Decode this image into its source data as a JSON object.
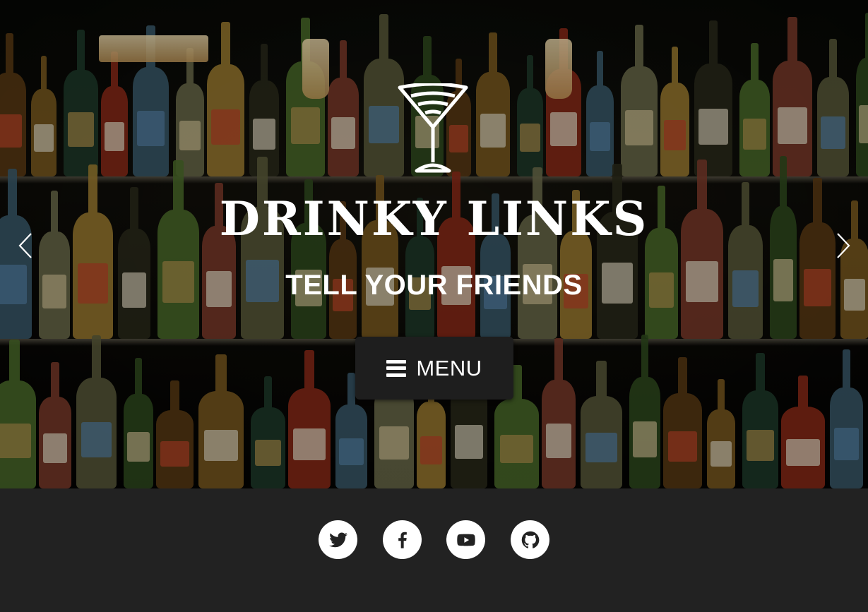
{
  "hero": {
    "brand_title": "DRINKY LINKS",
    "tagline": "TELL YOUR FRIENDS",
    "menu_button": {
      "label": "MENU",
      "icon": "hamburger-icon"
    },
    "carousel": {
      "prev_icon": "chevron-left-icon",
      "next_icon": "chevron-right-icon"
    },
    "logo_icon": "martini-glass-icon"
  },
  "footer": {
    "social_links": [
      {
        "name": "Twitter",
        "icon": "twitter-icon"
      },
      {
        "name": "Facebook",
        "icon": "facebook-icon"
      },
      {
        "name": "YouTube",
        "icon": "youtube-icon"
      },
      {
        "name": "GitHub",
        "icon": "github-icon"
      }
    ]
  },
  "colors": {
    "footer_bg": "#222222",
    "menu_bg": "#1e1e1e",
    "text": "#ffffff",
    "social_icon": "#222222",
    "social_bg": "#ffffff"
  }
}
